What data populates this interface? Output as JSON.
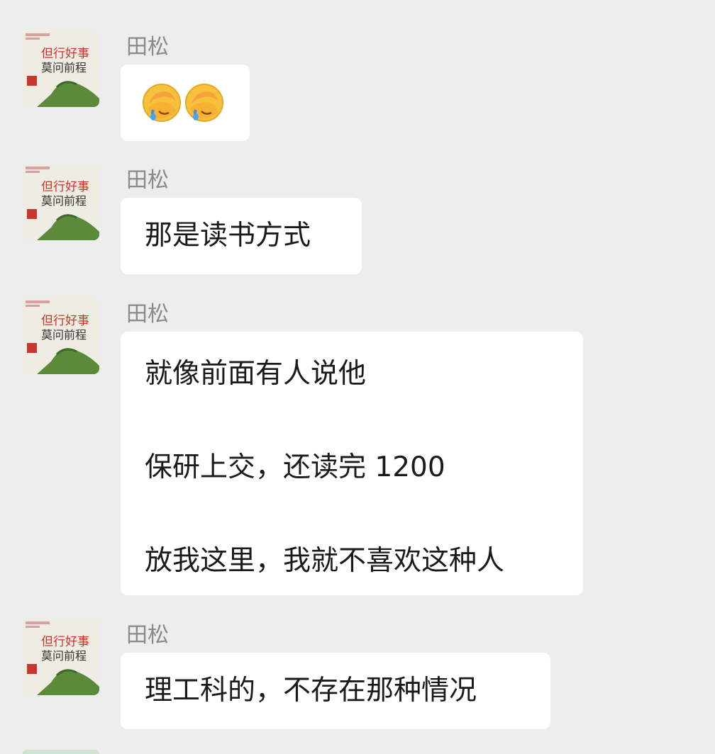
{
  "messages": [
    {
      "sender": "田松",
      "type": "emoji",
      "emojis": [
        "facepalm-icon",
        "facepalm-icon"
      ]
    },
    {
      "sender": "田松",
      "type": "text",
      "lines": [
        "那是读书方式"
      ]
    },
    {
      "sender": "田松",
      "type": "text",
      "lines": [
        "就像前面有人说他",
        "保研上交，还读完 1200",
        "放我这里，我就不喜欢这种人"
      ]
    },
    {
      "sender": "田松",
      "type": "text",
      "lines": [
        "理工科的，不存在那种情况"
      ]
    }
  ],
  "avatar": {
    "line1": "但行好事",
    "line2": "莫问前程"
  },
  "colors": {
    "background": "#ededed",
    "bubble": "#ffffff",
    "sender_name": "#8a8a8a",
    "avatar_red": "#c8372d",
    "avatar_green": "#5a8a3a"
  }
}
